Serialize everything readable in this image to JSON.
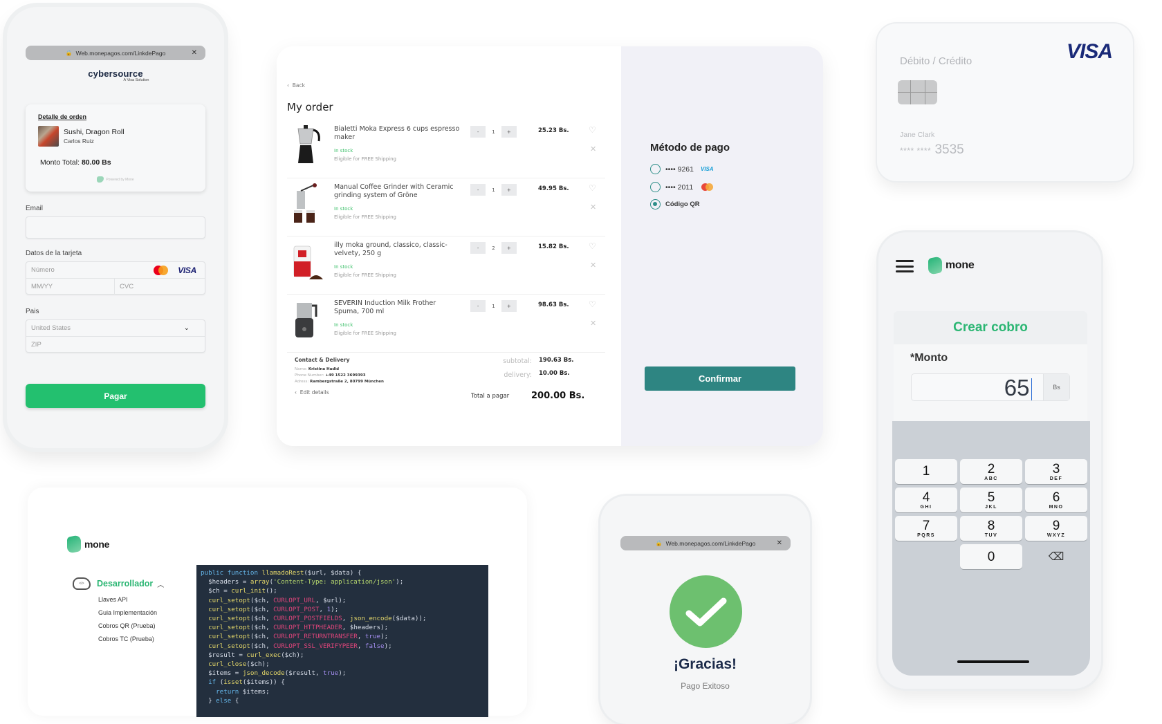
{
  "cybersource_phone": {
    "url": "Web.monepagos.com/LinkdePago",
    "brand": "cybersource",
    "brand_sub": "A Visa Solution",
    "order_card": {
      "title": "Detalle de orden",
      "product": "Sushi, Dragon Roll",
      "customer": "Carlos Ruiz",
      "total_label": "Monto Total:",
      "total_value": "80.00 Bs",
      "powered": "Powered by Mone"
    },
    "email_label": "Email",
    "email_value": "",
    "card_label": "Datos de la tarjeta",
    "number_placeholder": "Número",
    "expiry_placeholder": "MM/YY",
    "cvc_placeholder": "CVC",
    "visa": "VISA",
    "country_label": "Pais",
    "country_value": "United States",
    "zip_placeholder": "ZIP",
    "pay_button": "Pagar"
  },
  "order": {
    "back": "Back",
    "title": "My order",
    "items": [
      {
        "name": "Bialetti Moka Express 6 cups espresso maker",
        "stock": "In stock",
        "shipping": "Eligible for FREE Shipping",
        "qty": "1",
        "price": "25.23 Bs."
      },
      {
        "name": "Manual Coffee Grinder with Ceramic grinding system of Gröne",
        "stock": "In stock",
        "shipping": "Eligible for FREE Shipping",
        "qty": "1",
        "price": "49.95 Bs."
      },
      {
        "name": "illy moka ground, classico, classic-velvety, 250 g",
        "stock": "In stock",
        "shipping": "Eligible for FREE Shipping",
        "qty": "2",
        "price": "15.82 Bs."
      },
      {
        "name": "SEVERIN Induction Milk Frother Spuma, 700 ml",
        "stock": "In stock",
        "shipping": "Eligible for FREE Shipping",
        "qty": "1",
        "price": "98.63 Bs."
      }
    ],
    "qty_minus": "-",
    "qty_plus": "+",
    "contact": {
      "title": "Contact & Delivery",
      "name_label": "Name:",
      "name": "Kristina Hadid",
      "phone_label": "Phone Number:",
      "phone": "+49 1522 3699393",
      "address_label": "Adress:",
      "address": "Rambergstraße 2, 80799 München",
      "edit": "Edit details"
    },
    "subtotal_label": "subtotal:",
    "subtotal": "190.63 Bs.",
    "delivery_label": "delivery:",
    "delivery": "10.00 Bs.",
    "total_label": "Total a pagar",
    "total": "200.00 Bs."
  },
  "payment_method": {
    "title": "Método de pago",
    "options": [
      {
        "label": "•••• 9261",
        "brand": "VISA",
        "selected": false
      },
      {
        "label": "•••• 2011",
        "brand": "mastercard",
        "selected": false
      },
      {
        "label": "Código QR",
        "selected": true
      }
    ],
    "confirm": "Confirmar"
  },
  "credit_card": {
    "type": "Débito / Crédito",
    "brand": "VISA",
    "holder": "Jane Clark",
    "masked": "**** ****",
    "last4": "3535"
  },
  "mone_phone": {
    "brand": "mone",
    "title": "Crear cobro",
    "amount_label": "*Monto",
    "amount_value": "65",
    "currency": "Bs",
    "keys": [
      {
        "d": "1",
        "l": ""
      },
      {
        "d": "2",
        "l": "ABC"
      },
      {
        "d": "3",
        "l": "DEF"
      },
      {
        "d": "4",
        "l": "GHI"
      },
      {
        "d": "5",
        "l": "JKL"
      },
      {
        "d": "6",
        "l": "MNO"
      },
      {
        "d": "7",
        "l": "PQRS"
      },
      {
        "d": "8",
        "l": "TUV"
      },
      {
        "d": "9",
        "l": "WXYZ"
      },
      {
        "d": "0",
        "l": ""
      }
    ]
  },
  "developer": {
    "brand": "mone",
    "menu_title": "Desarrollador",
    "menu_items": [
      "Llaves API",
      "Guia Implementación",
      "Cobros QR (Prueba)",
      "Cobros TC (Prueba)"
    ]
  },
  "success_phone": {
    "url": "Web.monepagos.com/LinkdePago",
    "title": "¡Gracias!",
    "subtitle": "Pago Exitoso"
  },
  "colors": {
    "mone_green": "#2bb673",
    "pay_green": "#23c06f",
    "confirm_teal": "#2e8582",
    "success_green": "#6dc06f",
    "code_bg": "#232f3e"
  }
}
